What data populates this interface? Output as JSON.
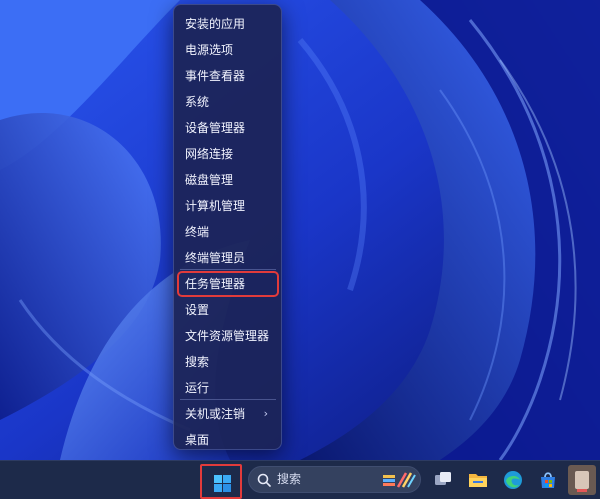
{
  "menu": {
    "items": [
      {
        "label": "安装的应用"
      },
      {
        "label": "电源选项"
      },
      {
        "label": "事件查看器"
      },
      {
        "label": "系统"
      },
      {
        "label": "设备管理器"
      },
      {
        "label": "网络连接"
      },
      {
        "label": "磁盘管理"
      },
      {
        "label": "计算机管理"
      },
      {
        "label": "终端"
      },
      {
        "label": "终端管理员"
      },
      {
        "label": "任务管理器",
        "highlighted": true
      },
      {
        "label": "设置"
      },
      {
        "label": "文件资源管理器"
      },
      {
        "label": "搜索"
      },
      {
        "label": "运行"
      },
      {
        "label": "关机或注销",
        "submenu": true
      },
      {
        "label": "桌面"
      }
    ]
  },
  "taskbar": {
    "search_label": "搜索",
    "icons": [
      "windows-start-icon",
      "search-icon",
      "task-view-icon",
      "file-explorer-icon",
      "edge-browser-icon",
      "store-icon",
      "app-icon"
    ]
  },
  "colors": {
    "highlight_border": "#e23b3b",
    "menu_bg": "#1c2456",
    "taskbar_bg": "#1d2a4a",
    "wallpaper_blue": "#1f3fe0"
  }
}
